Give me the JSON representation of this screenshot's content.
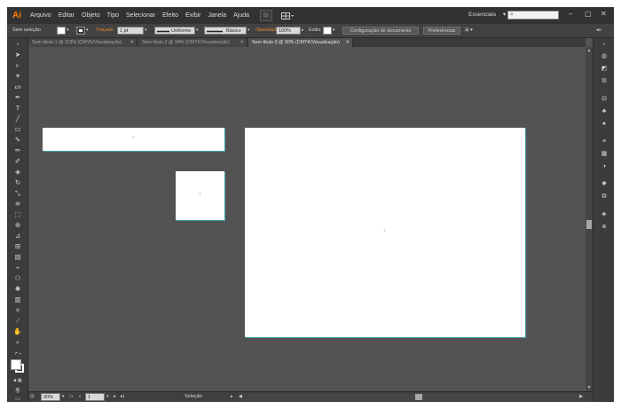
{
  "app": {
    "logo": "Ai"
  },
  "menu": [
    "Arquivo",
    "Editar",
    "Objeto",
    "Tipo",
    "Selecionar",
    "Efeito",
    "Exibir",
    "Janela",
    "Ajuda"
  ],
  "workspace": {
    "label": "Essenciais",
    "chevron": "▾"
  },
  "search": {
    "placeholder": ""
  },
  "window_controls": {
    "minimize": "–",
    "restore": "▢",
    "close": "✕"
  },
  "controlbar": {
    "selection": "Sem seleção",
    "stroke_label": "Traçado",
    "stroke_weight": "1 pt",
    "profile_uniform": "Uniforme",
    "brush_basic": "Básico",
    "opacity_label": "Opacidade",
    "opacity_value": "100%",
    "style_label": "Estilo",
    "doc_setup": "Configuração de documento",
    "preferences": "Preferências"
  },
  "tabs": [
    {
      "label": "Sem título-1 @ 119% (CMYK/Visualização)",
      "close": "✕"
    },
    {
      "label": "Sem título-2 @ 34% (CMYK/Visualização)",
      "close": "✕"
    },
    {
      "label": "Sem título-3 @ 90% (CMYK/Visualização)",
      "close": "✕",
      "active": true
    }
  ],
  "statusbar": {
    "zoom": "90%",
    "page": "1",
    "tool_status": "Seleção",
    "first": "|◂",
    "prev": "◂",
    "next": "▸",
    "last": "▸|",
    "dropdown": "▾",
    "arrow": "▸"
  },
  "icons": {
    "selection": "selection-tool-icon",
    "direct": "direct-selection-icon"
  },
  "colors": {
    "accent": "#e6892e",
    "logo": "#ff7c00",
    "artboard": "#ffffff",
    "canvas": "#535353"
  }
}
